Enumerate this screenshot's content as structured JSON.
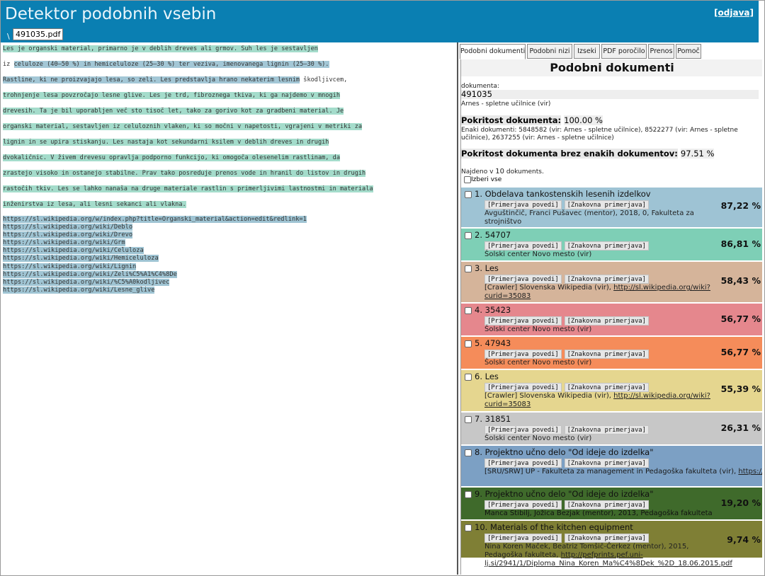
{
  "header": {
    "title": "Detektor podobnih vsebin",
    "logout": "[odjava]",
    "file_tab": "491035.pdf",
    "marker": "\\"
  },
  "document_text": {
    "lines": [
      {
        "text": "Les je organski material, primarno je v deblih dreves ali grmov. Suh les je sestavljen",
        "hl": "#a4dccb",
        "plain_after": ""
      },
      {
        "text": "iz celuloze (40–50 %) in hemiceluloze (25–30 %) ter veziva, imenovanega lignin (25–30 %).",
        "hl": "#a3c7d6",
        "plain_before": "iz ",
        "body": "celuloze (40–50 %) in hemiceluloze (25–30 %) ter veziva, imenovanega lignin (25–30 %)."
      },
      {
        "text": "Rastline, ki ne proizvajajo lesa, so zeli. Les predstavlja hrano nekaterim lesnim škodljivcem,",
        "hl": "#a3c7d6",
        "body": "Rastline, ki ne proizvajajo lesa, so zeli. Les predstavlja hrano nekaterim lesnim",
        "plain_after": " škodljivcem,"
      },
      {
        "text": "trohnjenje lesa povzročajo lesne glive. Les je trd, fibroznega tkiva, ki ga najdemo v mnogih",
        "hl": "#a4dccb"
      },
      {
        "text": "drevesih. Ta je bil uporabljen več sto tisoč let, tako za gorivo kot za gradbeni material. Je",
        "hl": "#a4dccb"
      },
      {
        "text": "organski material, sestavljen iz celuloznih vlaken, ki so močni v napetosti, vgrajeni v metriki za",
        "hl": "#a4dccb"
      },
      {
        "text": "lignin in se upira stiskanju. Les nastaja kot sekundarni ksilem v deblih dreves in drugih",
        "hl": "#a4dccb"
      },
      {
        "text": "dvokaličnic. V živem drevesu opravlja podporno funkcijo, ki omogoča olesenelim rastlinam, da",
        "hl": "#a4dccb"
      },
      {
        "text": "zrastejo visoko in ostanejo stabilne. Prav tako posreduje prenos vode in hranil do listov in drugih",
        "hl": "#a4dccb"
      },
      {
        "text": "rastočih tkiv. Les se lahko nanaša na druge materiale rastlin s primerljivimi lastnostmi in materiala",
        "hl": "#a4dccb"
      },
      {
        "text": "inženirstva iz lesa, ali lesni sekanci ali vlakna.",
        "hl": "#a4dccb"
      }
    ],
    "links": [
      "https://sl.wikipedia.org/w/index.php?title=Organski_material&action=edit&redlink=1",
      "https://sl.wikipedia.org/wiki/Deblo",
      "https://sl.wikipedia.org/wiki/Drevo",
      "https://sl.wikipedia.org/wiki/Grm",
      "https://sl.wikipedia.org/wiki/Celuloza",
      "https://sl.wikipedia.org/wiki/Hemiceluloza",
      "https://sl.wikipedia.org/wiki/Lignin",
      "https://sl.wikipedia.org/wiki/Zeli%C5%A1%C4%8De",
      "https://sl.wikipedia.org/wiki/%C5%A0kodljivec",
      "https://sl.wikipedia.org/wiki/Lesne_glive"
    ]
  },
  "tabs": [
    "Podobni dokumenti",
    "Podobni nizi",
    "Izseki",
    "PDF poročilo",
    "Prenos",
    "Pomoč"
  ],
  "panel": {
    "title": "Podobni dokumenti",
    "doc_label": "dokumenta:",
    "doc_id": "491035",
    "doc_source": "Arnes - spletne učilnice (vir)",
    "coverage_label": "Pokritost dokumenta:",
    "coverage_value": "100.00 %",
    "same_docs": "Enaki dokumenti: 5848582 (vir: Arnes - spletne učilnice), 8522277 (vir: Arnes - spletne učilnice), 2637255 (vir: Arnes - spletne učilnice)",
    "coverage2_label": "Pokritost dokumenta brez enakih dokumentov:",
    "coverage2_value": "97.51 %",
    "found_prefix": "Najdeno v",
    "found_count": "10",
    "found_suffix": "dokuments.",
    "select_all": "Izberi vse",
    "btn_sentence": "[Primerjava povedi]",
    "btn_char": "[Znakovna primerjava]"
  },
  "results": [
    {
      "title": "1. Obdelava tankostenskih lesenih izdelkov",
      "meta": " Avguštinčič, Franci Pušavec (mentor), 2018, 0, Fakulteta za strojništvo",
      "link": "",
      "pct": "87,22 %",
      "color": "#9ec3d4",
      "text_color": "#222222"
    },
    {
      "title": "2. 54707",
      "meta": "Šolski center Novo mesto (vir)",
      "link": "",
      "pct": "86,81 %",
      "color": "#7ecfb6",
      "text_color": "#222222"
    },
    {
      "title": "3. Les",
      "meta": "[Crawler] Slovenska Wikipedia (vir), ",
      "link": "http://sl.wikipedia.org/wiki?curid=35083",
      "pct": "58,43 %",
      "color": "#d5b49a",
      "text_color": "#222222"
    },
    {
      "title": "4. 35423",
      "meta": "Šolski center Novo mesto (vir)",
      "link": "",
      "pct": "56,77 %",
      "color": "#e5878d",
      "text_color": "#222222"
    },
    {
      "title": "5. 47943",
      "meta": "Šolski center Novo mesto (vir)",
      "link": "",
      "pct": "56,77 %",
      "color": "#f58c5a",
      "text_color": "#222222"
    },
    {
      "title": "6. Les",
      "meta": "[Crawler] Slovenska Wikipedia (vir), ",
      "link": "http://sl.wikipedia.org/wiki?curid=35083",
      "pct": "55,39 %",
      "color": "#e5d68f",
      "text_color": "#222222"
    },
    {
      "title": "7. 31851",
      "meta": "Šolski center Novo mesto (vir)",
      "link": "",
      "pct": "26,31 %",
      "color": "#c7c7c7",
      "text_color": "#222222"
    },
    {
      "title": "8. Projektno učno delo \"Od ideje do izdelka\"",
      "meta": "[SRU/SRW] UP - Fakulteta za management in Pedagoška fakulteta (vir), ",
      "link": "https://share.upr.si/PEF/EDIPLOME/DIPLOMSKE_NALOGE/Stibilj_Manca_2013.pdf",
      "pct": "",
      "color": "#7ca0c4",
      "text_color": "#1a1a1a"
    },
    {
      "title": "9. Projektno učno delo \"Od ideje do izdelka\"",
      "meta": "Manca Stibilj, Jožica Bezjak (mentor), 2013, Pedagoška fakulteta",
      "link": "",
      "pct": "19,20 %",
      "color": "#3f6a2b",
      "text_color": "#111111"
    },
    {
      "title": "10. Materials of the kitchen equipment",
      "meta": "Nina Koren Maček, Beatriz Tomšič-Čerkez (mentor), 2015, Pedagoška fakulteta, ",
      "link": "http://pefprints.pef.uni-lj.si/2941/1/Diploma_Nina_Koren_Ma%C4%8Dek_%2D_18.06.2015.pdf",
      "pct": "9,74 %",
      "color": "#7f7f35",
      "text_color": "#222222"
    }
  ]
}
